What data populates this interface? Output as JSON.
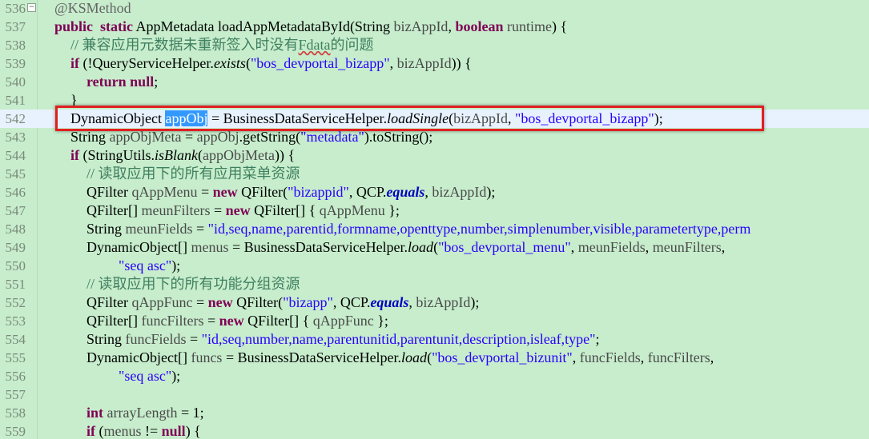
{
  "lines": [
    {
      "no": "536",
      "fold": true,
      "segments": [
        [
          "ann",
          "@KSMethod"
        ]
      ]
    },
    {
      "no": "537",
      "segments": [
        [
          "kw",
          "public"
        ],
        [
          "",
          "  "
        ],
        [
          "kw",
          "static"
        ],
        [
          "",
          " AppMetadata loadAppMetadataById(String "
        ],
        [
          "var",
          "bizAppId"
        ],
        [
          "",
          ", "
        ],
        [
          "kw",
          "boolean"
        ],
        [
          "",
          " "
        ],
        [
          "var",
          "runtime"
        ],
        [
          "",
          ") {"
        ]
      ]
    },
    {
      "no": "538",
      "segments": [
        [
          "cmt",
          "// 兼容应用元数据未重新签入时没有"
        ],
        [
          "cmt squig",
          "Fdata"
        ],
        [
          "cmt",
          "的问题"
        ]
      ]
    },
    {
      "no": "539",
      "segments": [
        [
          "kw",
          "if"
        ],
        [
          "",
          " (!QueryServiceHelper."
        ],
        [
          "it",
          "exists"
        ],
        [
          "",
          "("
        ],
        [
          "str",
          "\"bos_devportal_bizapp\""
        ],
        [
          "",
          ", "
        ],
        [
          "var",
          "bizAppId"
        ],
        [
          "",
          ")) {"
        ]
      ]
    },
    {
      "no": "540",
      "segments": [
        [
          "kw",
          "return"
        ],
        [
          "",
          " "
        ],
        [
          "kw",
          "null"
        ],
        [
          "",
          ";"
        ]
      ]
    },
    {
      "no": "541",
      "segments": [
        [
          "",
          "}"
        ]
      ]
    },
    {
      "no": "542",
      "current": true,
      "segments": [
        [
          "",
          "DynamicObject "
        ],
        [
          "sel",
          "appObj"
        ],
        [
          "",
          " = BusinessDataServiceHelper."
        ],
        [
          "it",
          "loadSingle"
        ],
        [
          "",
          "("
        ],
        [
          "var",
          "bizAppId"
        ],
        [
          "",
          ", "
        ],
        [
          "str",
          "\"bos_devportal_bizapp\""
        ],
        [
          "",
          ");"
        ]
      ]
    },
    {
      "no": "543",
      "segments": [
        [
          "",
          "String "
        ],
        [
          "var",
          "appObjMeta"
        ],
        [
          "",
          " = "
        ],
        [
          "var",
          "appObj"
        ],
        [
          "",
          ".getString("
        ],
        [
          "str",
          "\"metadata\""
        ],
        [
          "",
          ").toString();"
        ]
      ]
    },
    {
      "no": "544",
      "segments": [
        [
          "kw",
          "if"
        ],
        [
          "",
          " (StringUtils."
        ],
        [
          "it",
          "isBlank"
        ],
        [
          "",
          "("
        ],
        [
          "var",
          "appObjMeta"
        ],
        [
          "",
          ")) {"
        ]
      ]
    },
    {
      "no": "545",
      "segments": [
        [
          "cmt",
          "// 读取应用下的所有应用菜单资源"
        ]
      ]
    },
    {
      "no": "546",
      "segments": [
        [
          "",
          "QFilter "
        ],
        [
          "var",
          "qAppMenu"
        ],
        [
          "",
          " = "
        ],
        [
          "kw",
          "new"
        ],
        [
          "",
          " QFilter("
        ],
        [
          "str",
          "\"bizappid\""
        ],
        [
          "",
          ", QCP."
        ],
        [
          "bi",
          "equals"
        ],
        [
          "",
          ", "
        ],
        [
          "var",
          "bizAppId"
        ],
        [
          "",
          ");"
        ]
      ]
    },
    {
      "no": "547",
      "segments": [
        [
          "",
          "QFilter[] "
        ],
        [
          "var",
          "meunFilters"
        ],
        [
          "",
          " = "
        ],
        [
          "kw",
          "new"
        ],
        [
          "",
          " QFilter[] { "
        ],
        [
          "var",
          "qAppMenu"
        ],
        [
          "",
          " };"
        ]
      ]
    },
    {
      "no": "548",
      "segments": [
        [
          "",
          "String "
        ],
        [
          "var",
          "meunFields"
        ],
        [
          "",
          " = "
        ],
        [
          "str",
          "\"id,seq,name,parentid,formname,openttype,number,simplenumber,visible,parametertype,perm"
        ]
      ]
    },
    {
      "no": "549",
      "segments": [
        [
          "",
          "DynamicObject[] "
        ],
        [
          "var",
          "menus"
        ],
        [
          "",
          " = BusinessDataServiceHelper."
        ],
        [
          "it",
          "load"
        ],
        [
          "",
          "("
        ],
        [
          "str",
          "\"bos_devportal_menu\""
        ],
        [
          "",
          ", "
        ],
        [
          "var",
          "meunFields"
        ],
        [
          "",
          ", "
        ],
        [
          "var",
          "meunFilters"
        ],
        [
          "",
          ","
        ]
      ]
    },
    {
      "no": "550",
      "segments": [
        [
          "str",
          "\"seq asc\""
        ],
        [
          "",
          ");"
        ]
      ]
    },
    {
      "no": "551",
      "segments": [
        [
          "cmt",
          "// 读取应用下的所有功能分组资源"
        ]
      ]
    },
    {
      "no": "552",
      "segments": [
        [
          "",
          "QFilter "
        ],
        [
          "var",
          "qAppFunc"
        ],
        [
          "",
          " = "
        ],
        [
          "kw",
          "new"
        ],
        [
          "",
          " QFilter("
        ],
        [
          "str",
          "\"bizapp\""
        ],
        [
          "",
          ", QCP."
        ],
        [
          "bi",
          "equals"
        ],
        [
          "",
          ", "
        ],
        [
          "var",
          "bizAppId"
        ],
        [
          "",
          ");"
        ]
      ]
    },
    {
      "no": "553",
      "segments": [
        [
          "",
          "QFilter[] "
        ],
        [
          "var",
          "funcFilters"
        ],
        [
          "",
          " = "
        ],
        [
          "kw",
          "new"
        ],
        [
          "",
          " QFilter[] { "
        ],
        [
          "var",
          "qAppFunc"
        ],
        [
          "",
          " };"
        ]
      ]
    },
    {
      "no": "554",
      "segments": [
        [
          "",
          "String "
        ],
        [
          "var",
          "funcFields"
        ],
        [
          "",
          " = "
        ],
        [
          "str",
          "\"id,seq,number,name,parentunitid,parentunit,description,isleaf,type\""
        ],
        [
          "",
          ";"
        ]
      ]
    },
    {
      "no": "555",
      "segments": [
        [
          "",
          "DynamicObject[] "
        ],
        [
          "var",
          "funcs"
        ],
        [
          "",
          " = BusinessDataServiceHelper."
        ],
        [
          "it",
          "load"
        ],
        [
          "",
          "("
        ],
        [
          "str",
          "\"bos_devportal_bizunit\""
        ],
        [
          "",
          ", "
        ],
        [
          "var",
          "funcFields"
        ],
        [
          "",
          ", "
        ],
        [
          "var",
          "funcFilters"
        ],
        [
          "",
          ","
        ]
      ]
    },
    {
      "no": "556",
      "segments": [
        [
          "str",
          "\"seq asc\""
        ],
        [
          "",
          ");"
        ]
      ]
    },
    {
      "no": "557",
      "segments": []
    },
    {
      "no": "558",
      "segments": [
        [
          "kw",
          "int"
        ],
        [
          "",
          " "
        ],
        [
          "var",
          "arrayLength"
        ],
        [
          "",
          " = 1;"
        ]
      ]
    },
    {
      "no": "559",
      "segments": [
        [
          "kw",
          "if"
        ],
        [
          "",
          " ("
        ],
        [
          "var",
          "menus"
        ],
        [
          "",
          " != "
        ],
        [
          "kw",
          "null"
        ],
        [
          "",
          ") {"
        ]
      ]
    }
  ]
}
